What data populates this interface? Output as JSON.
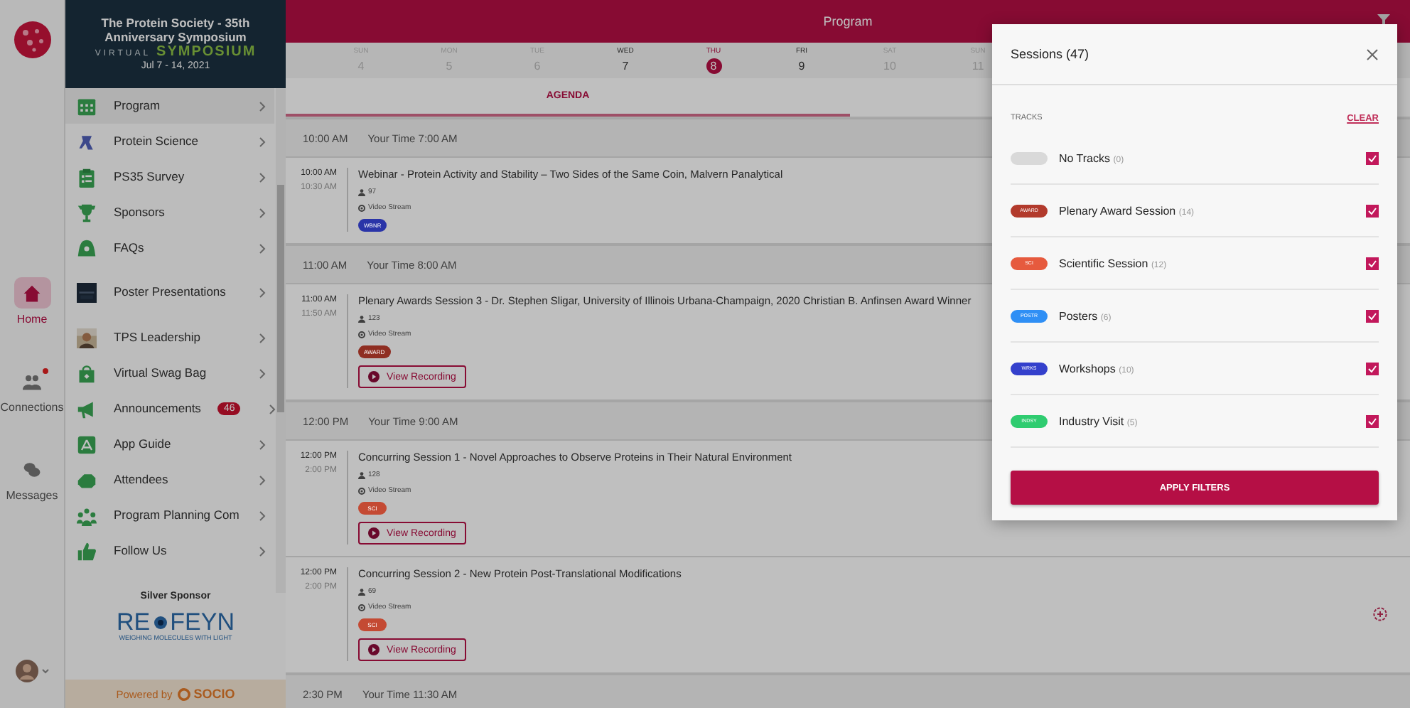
{
  "rail": {
    "items": [
      {
        "label": "Home",
        "selected": true,
        "badge": false
      },
      {
        "label": "Connections",
        "selected": false,
        "badge": true
      },
      {
        "label": "Messages",
        "selected": false,
        "badge": false
      }
    ]
  },
  "banner": {
    "title": "The Protein Society - 35th Anniversary Symposium",
    "art_top": "VIRTUAL",
    "art_bottom": "SYMPOSIUM",
    "dates": "Jul 7 - 14, 2021"
  },
  "menu": [
    {
      "label": "Program",
      "selected": true
    },
    {
      "label": "Protein Science",
      "selected": false
    },
    {
      "label": "PS35 Survey",
      "selected": false
    },
    {
      "label": "Sponsors",
      "selected": false
    },
    {
      "label": "FAQs",
      "selected": false
    },
    {
      "label": "Poster Presentations",
      "selected": false
    },
    {
      "label": "TPS Leadership",
      "selected": false
    },
    {
      "label": "Virtual Swag Bag",
      "selected": false
    },
    {
      "label": "Announcements",
      "selected": false,
      "badge": "46"
    },
    {
      "label": "App Guide",
      "selected": false
    },
    {
      "label": "Attendees",
      "selected": false
    },
    {
      "label": "Program Planning Com",
      "selected": false
    },
    {
      "label": "Follow Us",
      "selected": false
    }
  ],
  "sponsor": {
    "heading": "Silver Sponsor",
    "logo_left": "RE",
    "logo_right": "FEYN",
    "tagline": "WEIGHING MOLECULES WITH LIGHT"
  },
  "footer": {
    "prefix": "Powered by",
    "brand": "SOCIO"
  },
  "header": {
    "title": "Program"
  },
  "days": [
    {
      "weekday": "SUN",
      "day": "4",
      "disabled": true,
      "selected": false
    },
    {
      "weekday": "MON",
      "day": "5",
      "disabled": true,
      "selected": false
    },
    {
      "weekday": "TUE",
      "day": "6",
      "disabled": true,
      "selected": false
    },
    {
      "weekday": "WED",
      "day": "7",
      "disabled": false,
      "selected": false
    },
    {
      "weekday": "THU",
      "day": "8",
      "disabled": false,
      "selected": true
    },
    {
      "weekday": "FRI",
      "day": "9",
      "disabled": false,
      "selected": false
    },
    {
      "weekday": "SAT",
      "day": "10",
      "disabled": true,
      "selected": false
    },
    {
      "weekday": "SUN",
      "day": "11",
      "disabled": true,
      "selected": false
    }
  ],
  "tabs": [
    {
      "label": "AGENDA",
      "selected": true
    }
  ],
  "agenda": [
    {
      "time": "10:00 AM",
      "your_time": "Your Time 7:00 AM",
      "sessions": [
        {
          "start": "10:00 AM",
          "end": "10:30 AM",
          "title": "Webinar - Protein Activity and Stability – Two Sides of the Same Coin, Malvern Panalytical",
          "attendees": "97",
          "stream": "Video Stream",
          "tag": {
            "label": "WBNR",
            "color": "#2a34a8"
          }
        }
      ]
    },
    {
      "time": "11:00 AM",
      "your_time": "Your Time 8:00 AM",
      "sessions": [
        {
          "start": "11:00 AM",
          "end": "11:50 AM",
          "title": "Plenary Awards Session 3 - Dr. Stephen Sligar, University of Illinois Urbana-Champaign, 2020 Christian B. Anfinsen Award Winner",
          "attendees": "123",
          "stream": "Video Stream",
          "tag": {
            "label": "AWARD",
            "color": "#8f2e22"
          },
          "recording": "View Recording"
        }
      ]
    },
    {
      "time": "12:00 PM",
      "your_time": "Your Time 9:00 AM",
      "sessions": [
        {
          "start": "12:00 PM",
          "end": "2:00 PM",
          "title": "Concurring Session 1 - Novel Approaches to Observe Proteins in Their Natural Environment",
          "attendees": "128",
          "stream": "Video Stream",
          "tag": {
            "label": "SCI",
            "color": "#c44a33"
          },
          "recording": "View Recording"
        },
        {
          "start": "12:00 PM",
          "end": "2:00 PM",
          "title": "Concurring Session 2 - New Protein Post-Translational Modifications",
          "attendees": "69",
          "stream": "Video Stream",
          "tag": {
            "label": "SCI",
            "color": "#c44a33"
          },
          "recording": "View Recording",
          "add_button": true
        }
      ]
    },
    {
      "time": "2:30 PM",
      "your_time": "Your Time 11:30 AM"
    }
  ],
  "filter": {
    "title": "Sessions (47)",
    "section": "TRACKS",
    "clear": "CLEAR",
    "apply": "APPLY FILTERS",
    "tracks": [
      {
        "name": "No Tracks",
        "count": "(0)",
        "color": "#d9d9d9",
        "checked": true
      },
      {
        "tag": "AWARD",
        "name": "Plenary Award Session",
        "count": "(14)",
        "color": "#b23a2c",
        "checked": true
      },
      {
        "tag": "SCI",
        "name": "Scientific Session",
        "count": "(12)",
        "color": "#e65a3e",
        "checked": true
      },
      {
        "tag": "POSTR",
        "name": "Posters",
        "count": "(6)",
        "color": "#2f8ff5",
        "checked": true
      },
      {
        "tag": "WRKS",
        "name": "Workshops",
        "count": "(10)",
        "color": "#3440cc",
        "checked": true
      },
      {
        "tag": "INDSY",
        "name": "Industry Visit",
        "count": "(5)",
        "color": "#2fcc70",
        "checked": true
      }
    ]
  }
}
